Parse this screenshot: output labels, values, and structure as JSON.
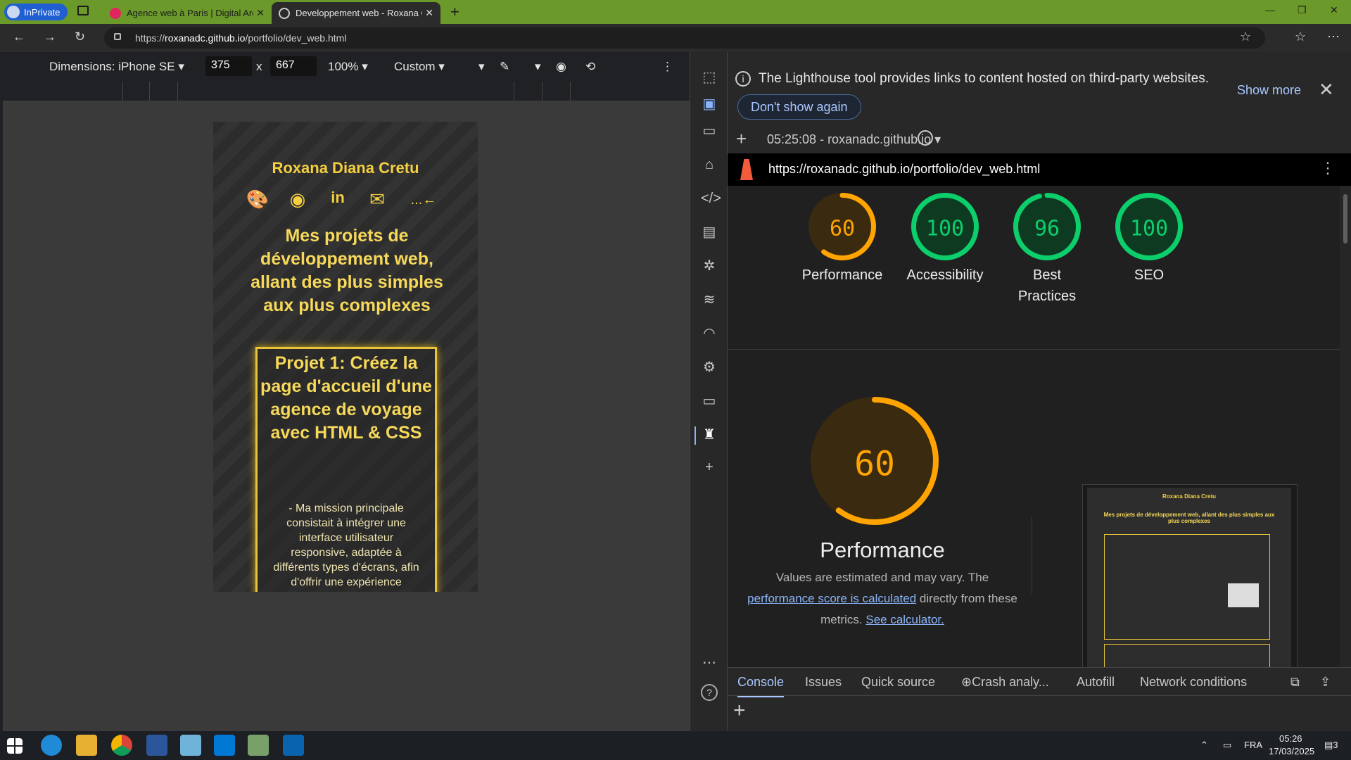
{
  "browser": {
    "inprivate_label": "InPrivate",
    "tabs": [
      {
        "title": "Agence web à Paris | Digital Arch",
        "active": false
      },
      {
        "title": "Developpement web - Roxana C",
        "active": true
      }
    ],
    "url_prefix": "https://",
    "url_host": "roxanadc.github.io",
    "url_path": "/portfolio/dev_web.html"
  },
  "device_toolbar": {
    "dimensions_label": "Dimensions: iPhone SE",
    "width": "375",
    "height": "667",
    "times": "x",
    "zoom": "100%",
    "throttle": "Custom"
  },
  "phone": {
    "name": "Roxana Diana Cretu",
    "icons": [
      "palette-icon",
      "github-icon",
      "linkedin-icon",
      "envelope-icon",
      "back-arrow-icon"
    ],
    "back_label": "...←",
    "heading": "Mes projets de développement web, allant des plus simples aux plus complexes",
    "card_title": "Projet 1: Créez la page d'accueil d'une agence de voyage avec HTML & CSS",
    "card_desc": "- Ma mission principale consistait à intégrer une interface utilisateur responsive, adaptée à différents types d'écrans, afin d'offrir une expérience",
    "accent": "#f4cf40"
  },
  "devtools": {
    "notice": "The Lighthouse tool provides links to content hosted on third-party websites.",
    "dont_show": "Don't show again",
    "show_more": "Show more",
    "run_label": "05:25:08 - roxanadc.github.io",
    "report_url": "https://roxanadc.github.io/portfolio/dev_web.html",
    "scores": [
      {
        "value": "60",
        "label": "Performance",
        "pct": 0.6,
        "color": "#ffa400"
      },
      {
        "value": "100",
        "label": "Accessibility",
        "pct": 1.0,
        "color": "#0cce6b"
      },
      {
        "value": "96",
        "label": "Best Practices",
        "pct": 0.96,
        "color": "#0cce6b"
      },
      {
        "value": "100",
        "label": "SEO",
        "pct": 1.0,
        "color": "#0cce6b"
      }
    ],
    "big_score": "60",
    "big_label": "Performance",
    "note_pre": "Values are estimated and may vary. The",
    "note_link": "performance score is calculated",
    "note_post": "directly from these",
    "note_line3": "metrics.",
    "note_link2": "See calculator.",
    "drawer_tabs": [
      "Console",
      "Issues",
      "Quick source",
      "Crash analy...",
      "Autofill",
      "Network conditions"
    ]
  },
  "taskbar": {
    "lang": "FRA",
    "time": "05:26",
    "date": "17/03/2025",
    "notif_count": "3"
  }
}
